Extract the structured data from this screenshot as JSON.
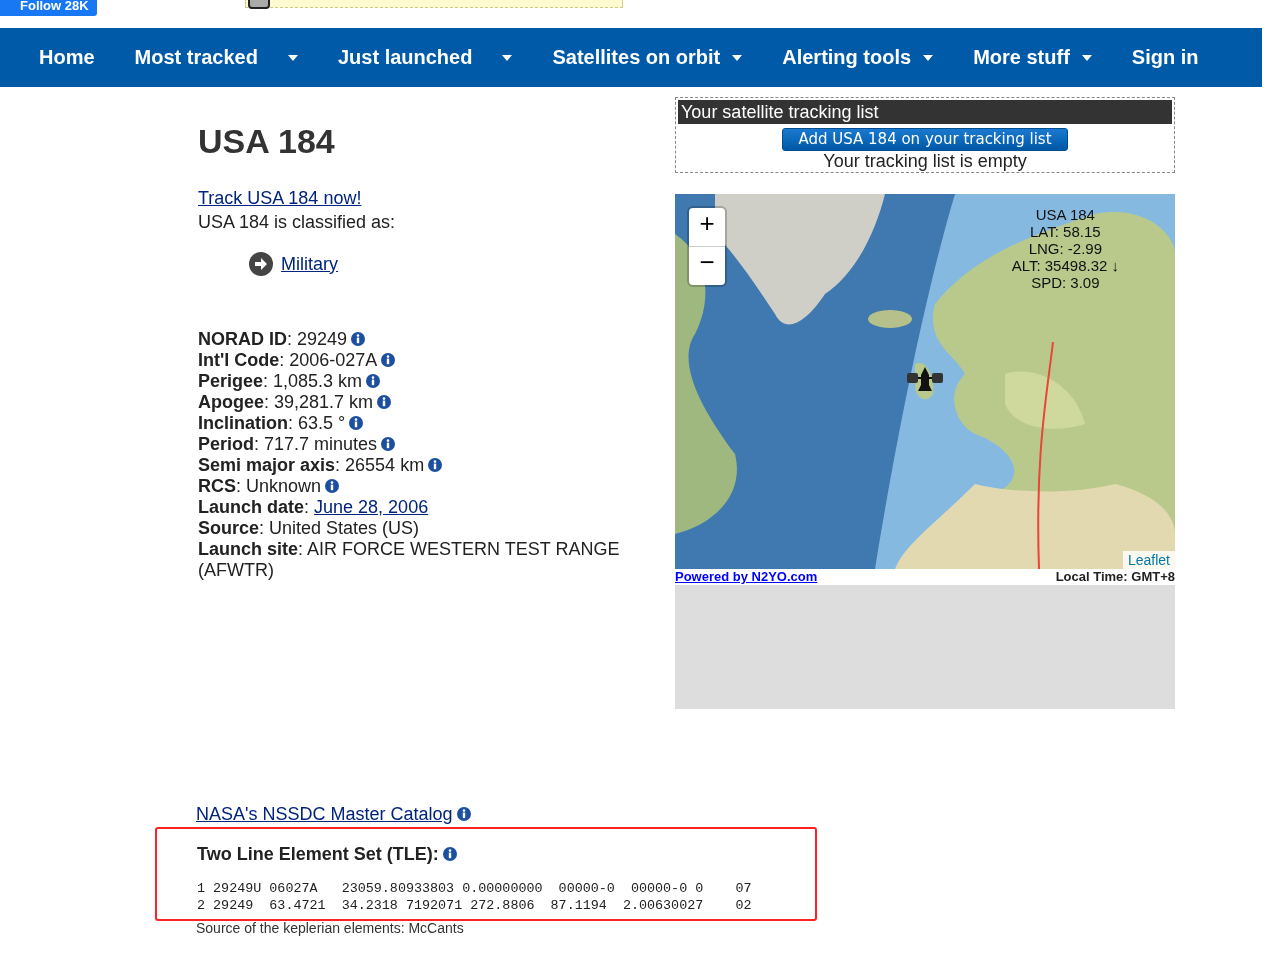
{
  "top_bar": {
    "follow_button": "Follow 28K"
  },
  "nav": [
    {
      "label": "Home",
      "dropdown": false
    },
    {
      "label": "Most tracked",
      "dropdown": true
    },
    {
      "label": "Just launched",
      "dropdown": true
    },
    {
      "label": "Satellites on orbit",
      "dropdown": true
    },
    {
      "label": "Alerting tools",
      "dropdown": true
    },
    {
      "label": "More stuff",
      "dropdown": true
    },
    {
      "label": "Sign in",
      "dropdown": false
    }
  ],
  "satellite": {
    "title": "USA 184",
    "track_link": "Track USA 184 now!",
    "classified_text": "USA 184 is classified as:",
    "category": "Military"
  },
  "details": [
    {
      "text": "**NORAD ID**: 29249",
      "kind": "text",
      "info": true
    },
    {
      "text": "**Int'l Code**: 2006-027A",
      "kind": "text",
      "info": true
    },
    {
      "text": "**Perigee**: 1,085.3 km",
      "kind": "text",
      "info": true
    },
    {
      "text": "**Apogee**: 39,281.7 km",
      "kind": "text",
      "info": true
    },
    {
      "text": "**Inclination**: 63.5 °",
      "kind": "text",
      "info": true
    },
    {
      "text": "**Period**: 717.7 minutes",
      "kind": "text",
      "info": true
    },
    {
      "text": "**Semi major axis**: 26554 km",
      "kind": "text",
      "info": true
    },
    {
      "text": "**RCS**: Unknown",
      "kind": "text",
      "info": true
    },
    {
      "text": "**Launch date**:",
      "link": "June 28, 2006",
      "kind": "link",
      "info": false
    },
    {
      "text": "**Source**: United States (US)",
      "kind": "text",
      "info": false
    },
    {
      "text": "**Launch site**: AIR FORCE WESTERN TEST RANGE (AFWTR)",
      "kind": "text",
      "info": false
    }
  ],
  "tracking_list": {
    "title": "Your satellite tracking list",
    "add_button": "Add USA 184 on your tracking list",
    "status": "Your tracking list is empty"
  },
  "map": {
    "zoom_in": "+",
    "zoom_out": "−",
    "info_lines": [
      "USA 184",
      "LAT: 58.15",
      "LNG: -2.99",
      "ALT: 35498.32 ↓",
      "SPD: 3.09"
    ],
    "attribution": "Leaflet",
    "powered_by": "Powered by N2YO.com",
    "local_time": "Local Time: GMT+8"
  },
  "catalog_link": "NASA's NSSDC Master Catalog",
  "tle": {
    "title": "Two Line Element Set (TLE):",
    "lines": [
      "1 29249U 06027A   23059.80933803 0.00000000  00000-0  00000-0 0    07",
      "2 29249  63.4721  34.2318 7192071 272.8806  87.1194  2.00630027    02"
    ],
    "source": "Source of the keplerian elements: McCants"
  }
}
